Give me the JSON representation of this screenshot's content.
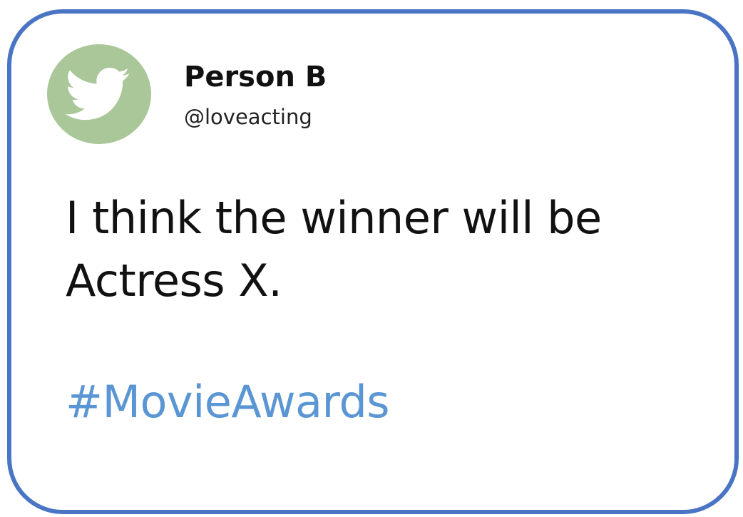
{
  "tweet": {
    "avatar_icon": "twitter-bird-icon",
    "author_name": "Person B",
    "author_handle": "@loveacting",
    "text_line1": "I think the winner will be",
    "text_line2": "Actress X.",
    "hashtag": "#MovieAwards"
  },
  "colors": {
    "card_border": "#4a74c4",
    "avatar_background": "#aac79a",
    "hashtag": "#5b96d4",
    "text": "#111111"
  }
}
